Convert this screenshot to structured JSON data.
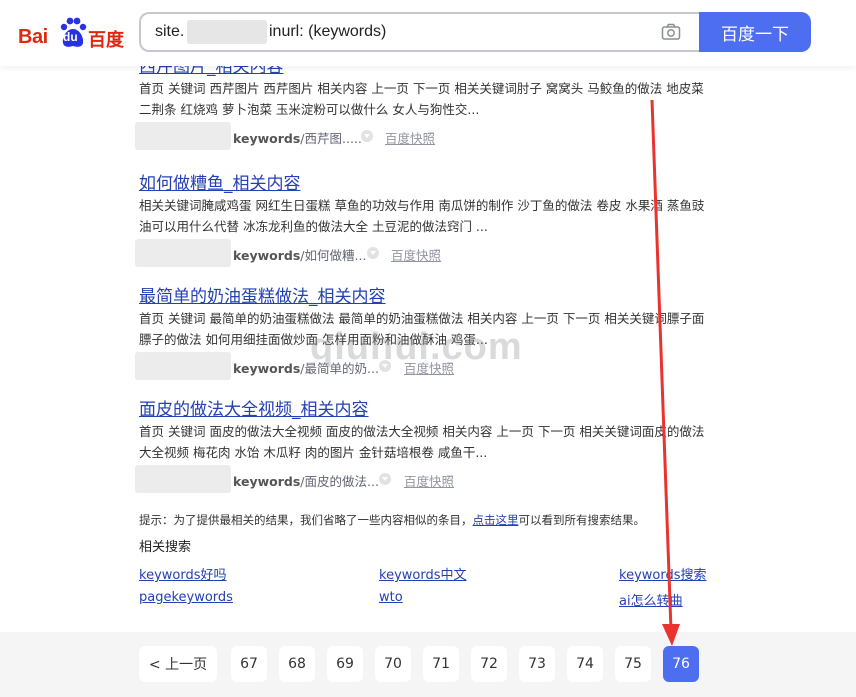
{
  "logo": {
    "bai": "Bai",
    "du": "du",
    "cn": "百度"
  },
  "search": {
    "prefix": "site.",
    "value": "inurl: (keywords)",
    "button": "百度一下"
  },
  "colors": {
    "brand_red": "#de2910",
    "accent_blue": "#4e6ef2",
    "link_blue": "#2440b3"
  },
  "results": [
    {
      "title": "西芹图片_相关内容",
      "desc": "首页 关键词 西芹图片 西芹图片 相关内容 上一页 下一页 相关关键词肘子 窝窝头 马鲛鱼的做法 地皮菜 二荆条 红烧鸡 萝卜泡菜 玉米淀粉可以做什么 女人与狗性交...",
      "url_bold": "keywords",
      "url_rest": "/西芹图.....",
      "snapshot": "百度快照"
    },
    {
      "title": "如何做糟鱼_相关内容",
      "desc": "相关关键词腌咸鸡蛋 网红生日蛋糕 草鱼的功效与作用 南瓜饼的制作 沙丁鱼的做法 卷皮 水果酒 蒸鱼豉油可以用什么代替 冰冻龙利鱼的做法大全 土豆泥的做法窍门 ...",
      "url_bold": "keywords",
      "url_rest": "/如何做糟...",
      "snapshot": "百度快照"
    },
    {
      "title": "最简单的奶油蛋糕做法_相关内容",
      "desc": "首页 关键词 最简单的奶油蛋糕做法 最简单的奶油蛋糕做法 相关内容 上一页 下一页 相关关键词膘子面膘子的做法 如何用细挂面做炒面 怎样用面粉和油做酥油 鸡蛋...",
      "url_bold": "keywords",
      "url_rest": "/最简单的奶...",
      "snapshot": "百度快照"
    },
    {
      "title": "面皮的做法大全视频_相关内容",
      "desc": "首页 关键词 面皮的做法大全视频 面皮的做法大全视频 相关内容 上一页 下一页 相关关键词面皮的做法大全视频 梅花肉 水饴 木瓜籽 肉的图片 金针菇培根卷 咸鱼干...",
      "url_bold": "keywords",
      "url_rest": "/面皮的做法...",
      "snapshot": "百度快照"
    }
  ],
  "tip": {
    "text": "提示：为了提供最相关的结果，我们省略了一些内容相似的条目，",
    "link": "点击这里",
    "suffix": "可以看到所有搜索结果。"
  },
  "related": {
    "title": "相关搜索",
    "links": [
      "keywords好吗",
      "keywords中文",
      "keywords搜索",
      "pagekeywords",
      "wto",
      "ai怎么转曲"
    ]
  },
  "pager": {
    "prev": "< 上一页",
    "pages": [
      "67",
      "68",
      "69",
      "70",
      "71",
      "72",
      "73",
      "74",
      "75",
      "76"
    ],
    "current": "76"
  },
  "watermark": "qiuhui.com"
}
